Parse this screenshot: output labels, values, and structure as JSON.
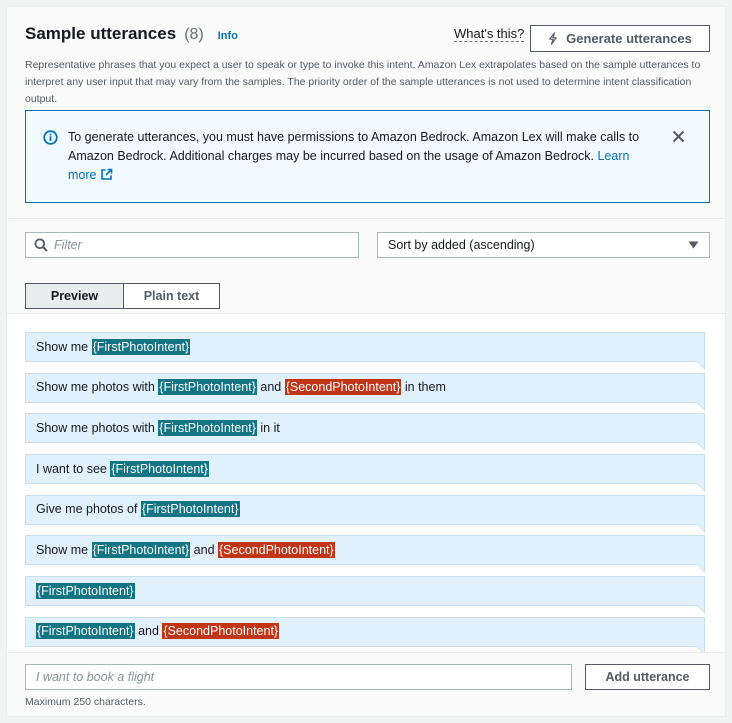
{
  "header": {
    "title": "Sample utterances",
    "count": "(8)",
    "info_link": "Info",
    "whats_this": "What's this?",
    "generate_label": "Generate utterances",
    "description": "Representative phrases that you expect a user to speak or type to invoke this intent. Amazon Lex extrapolates based on the sample utterances to interpret any user input that may vary from the samples. The priority order of the sample utterances is not used to determine intent classification output."
  },
  "alert": {
    "message": "To generate utterances, you must have permissions to Amazon Bedrock. Amazon Lex will make calls to Amazon Bedrock. Additional charges may be incurred based on the usage of Amazon Bedrock. ",
    "learn_more": "Learn more",
    "icons": {
      "info": "info-icon",
      "close": "close-icon",
      "external": "external-link-icon"
    }
  },
  "toolbar": {
    "filter_placeholder": "Filter",
    "sort_value": "Sort by added (ascending)",
    "tabs": [
      "Preview",
      "Plain text"
    ],
    "selected_tab": "Preview"
  },
  "utterances": [
    [
      {
        "t": "Show me "
      },
      {
        "s": "{FirstPhotoIntent}",
        "c": "teal"
      }
    ],
    [
      {
        "t": "Show me photos with "
      },
      {
        "s": "{FirstPhotoIntent}",
        "c": "teal"
      },
      {
        "t": " and "
      },
      {
        "s": "{SecondPhotoIntent}",
        "c": "red"
      },
      {
        "t": " in them"
      }
    ],
    [
      {
        "t": "Show me photos with "
      },
      {
        "s": "{FirstPhotoIntent}",
        "c": "teal"
      },
      {
        "t": " in it"
      }
    ],
    [
      {
        "t": "I want to see "
      },
      {
        "s": "{FirstPhotoIntent}",
        "c": "teal"
      }
    ],
    [
      {
        "t": "Give me photos of "
      },
      {
        "s": "{FirstPhotoIntent}",
        "c": "teal"
      }
    ],
    [
      {
        "t": "Show me "
      },
      {
        "s": "{FirstPhotoIntent}",
        "c": "teal"
      },
      {
        "t": " and "
      },
      {
        "s": "{SecondPhotoIntent}",
        "c": "red"
      }
    ],
    [
      {
        "s": "{FirstPhotoIntent}",
        "c": "teal"
      }
    ],
    [
      {
        "s": "{FirstPhotoIntent}",
        "c": "teal"
      },
      {
        "t": " and "
      },
      {
        "s": "{SecondPhotoIntent}",
        "c": "red"
      }
    ]
  ],
  "footer": {
    "input_placeholder": "I want to book a flight",
    "add_label": "Add utterance",
    "hint": "Maximum 250 characters."
  },
  "colors": {
    "slot_teal": "#137484",
    "slot_red": "#c23416",
    "link": "#0073bb",
    "utterance_bg": "#e0f1fb"
  }
}
